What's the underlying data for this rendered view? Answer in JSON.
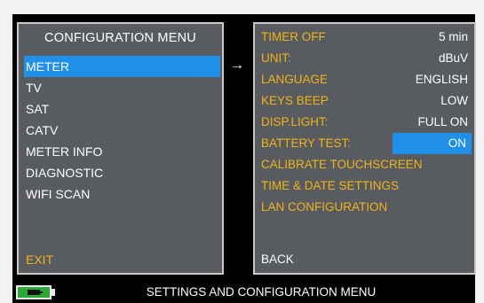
{
  "left_menu": {
    "title": "CONFIGURATION MENU",
    "items": [
      {
        "label": "METER",
        "selected": true
      },
      {
        "label": "TV"
      },
      {
        "label": "SAT"
      },
      {
        "label": "CATV"
      },
      {
        "label": "METER INFO"
      },
      {
        "label": "DIAGNOSTIC"
      },
      {
        "label": "WIFI SCAN"
      }
    ],
    "exit_label": "EXIT"
  },
  "arrow_symbol": "→",
  "right_menu": {
    "rows": [
      {
        "label": "TIMER OFF",
        "value": "5 min"
      },
      {
        "label": "UNIT:",
        "value": "dBuV"
      },
      {
        "label": "LANGUAGE",
        "value": "ENGLISH"
      },
      {
        "label": "KEYS BEEP",
        "value": "LOW"
      },
      {
        "label": "DISP.LIGHT:",
        "value": "FULL ON"
      },
      {
        "label": "BATTERY TEST:",
        "value": "ON",
        "highlighted": true
      },
      {
        "label": "CALIBRATE TOUCHSCREEN"
      },
      {
        "label": "TIME & DATE SETTINGS"
      },
      {
        "label": "LAN CONFIGURATION"
      }
    ],
    "back_label": "BACK"
  },
  "status_bar": {
    "text": "SETTINGS AND CONFIGURATION MENU",
    "battery_icon": "battery-charging-icon"
  },
  "colors": {
    "panel_bg": "#585c60",
    "highlight": "#1f8fe8",
    "label_yellow": "#f0b418",
    "text_white": "#ffffff"
  }
}
